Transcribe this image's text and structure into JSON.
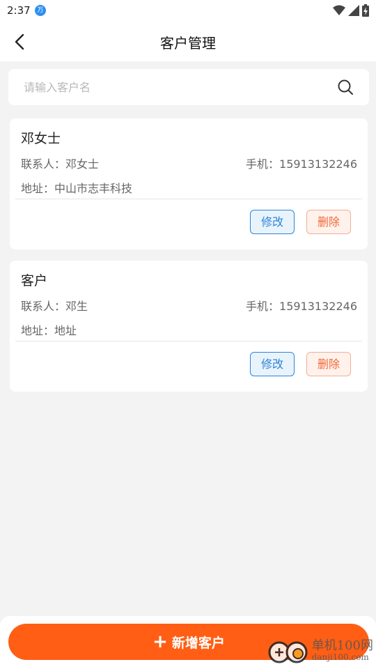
{
  "status_bar": {
    "time": "2:37",
    "app_badge": "万"
  },
  "header": {
    "title": "客户管理"
  },
  "search": {
    "placeholder": "请输入客户名"
  },
  "customers": [
    {
      "name": "邓女士",
      "contact": "联系人：邓女士",
      "phone": "手机：15913132246",
      "address": "地址：中山市志丰科技",
      "edit_label": "修改",
      "delete_label": "删除"
    },
    {
      "name": "客户",
      "contact": "联系人：邓生",
      "phone": "手机：15913132246",
      "address": "地址：地址",
      "edit_label": "修改",
      "delete_label": "删除"
    }
  ],
  "footer": {
    "add_label": "新增客户"
  },
  "watermark": {
    "main": "单机100网",
    "sub": "danji100.com"
  },
  "colors": {
    "accent": "#ff5e14",
    "edit": "#2b86d6",
    "delete": "#f06a3a",
    "background": "#f3f3f3"
  }
}
